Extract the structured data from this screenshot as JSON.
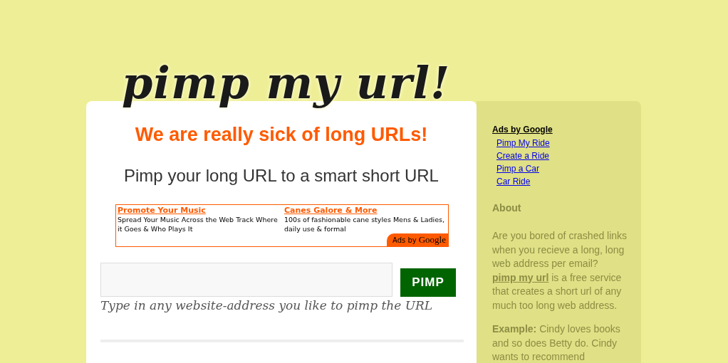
{
  "logo": "pimp my url!",
  "main": {
    "headline": "We are really sick of long URLs!",
    "tagline": "Pimp your long URL to a smart short URL",
    "ad_unit": {
      "ads": [
        {
          "title": "Promote Your Music",
          "text": "Spread Your Music Across the Web Track Where it Goes & Who Plays It"
        },
        {
          "title": "Canes Galore & More",
          "text": "100s of fashionable cane styles Mens & Ladies, daily use & formal"
        }
      ],
      "badge_prefix": "Ads by",
      "badge_brand": "Google"
    },
    "pimp_button": "PIMP",
    "hint": "Type in any website-address you like to pimp the URL"
  },
  "sidebar": {
    "ads_heading": "Ads by Google",
    "ad_links": [
      "Pimp My Ride",
      "Create a Ride",
      "Pimp a Car",
      "Car Ride"
    ],
    "about_heading": "About",
    "about": {
      "before": "Are you bored of crashed links when you recieve a long, long web address per email?",
      "link": "pimp my url",
      "after": "is a free service that creates a short url of any much too long web address."
    },
    "example": "**Example:** Cindy loves books and so does Betty do. Cindy wants to recommend"
  }
}
